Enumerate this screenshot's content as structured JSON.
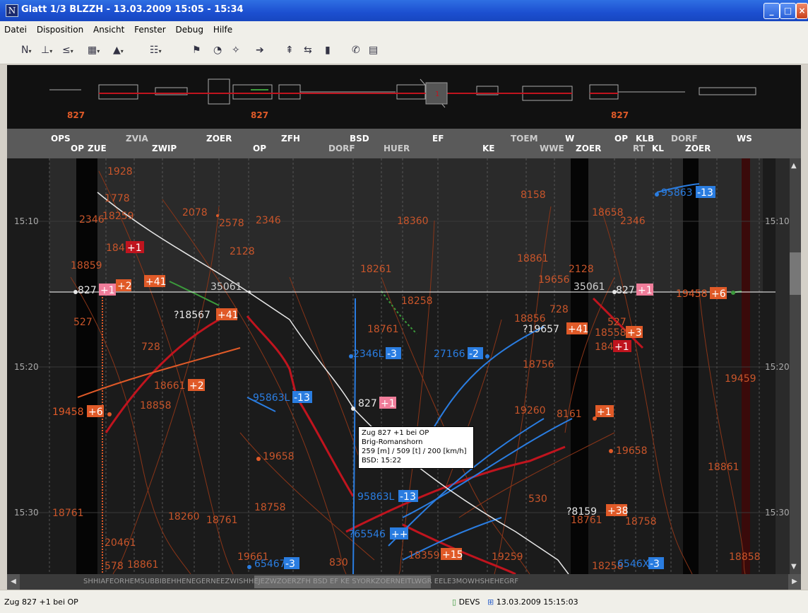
{
  "window": {
    "title": "Glatt 1/3 BLZZH - 13.03.2009 15:05 - 15:34",
    "icon": "N"
  },
  "menu": [
    "Datei",
    "Disposition",
    "Ansicht",
    "Fenster",
    "Debug",
    "Hilfe"
  ],
  "overview": {
    "train_labels": [
      "827",
      "827",
      "827"
    ],
    "box_label": "1"
  },
  "stations_top": [
    "OPS",
    "ZVIA",
    "ZOER",
    "ZFH",
    "BSD",
    "EF",
    "TOEM",
    "W",
    "OP",
    "KLB",
    "DORF",
    "WS"
  ],
  "stations_bottom": [
    "OP",
    "ZUE",
    "ZWIP",
    "OP",
    "DORF",
    "HUER",
    "KE",
    "WWE",
    "ZOER",
    "RT",
    "KL",
    "ZOER"
  ],
  "times_left": [
    "15:10",
    "15:20",
    "15:30"
  ],
  "times_right": [
    "15:10",
    "15:20",
    "15:30"
  ],
  "trains": {
    "t1928": "1928",
    "t1778": "1778",
    "t2346a": "2346",
    "t18259": "18259",
    "t2078": "2078",
    "t2578": "2578",
    "t2346b": "2346",
    "t18360": "18360",
    "t8158": "8158",
    "t95863a": "95863",
    "d95863a": "-13",
    "t18658": "18658",
    "t2346c": "2346",
    "t2128a": "2128",
    "t184a": "184",
    "d184a": "+1",
    "t18859": "18859",
    "t18261": "18261",
    "t18861a": "18861",
    "t2128b": "2128",
    "t19656": "19656",
    "t827a": "827",
    "d827a": "+1",
    "d2": "+2",
    "d41a": "+41",
    "t35061a": "35061",
    "t35061b": "35061",
    "t827b": "827",
    "d827b": "+1",
    "t19458a": "19458",
    "d6a": "+6",
    "t18258": "18258",
    "t527a": "527",
    "t728a": "728",
    "t18856": "18856",
    "t19657": "?19657",
    "d41b": "+41",
    "t18558": "18558",
    "d3": "+3",
    "t527b": "527",
    "t184b": "184",
    "d184b": "+1",
    "t18567": "?18567",
    "d41c": "+41",
    "t728b": "728",
    "t18761a": "18761",
    "t2346d": "2346L",
    "d2346d": "-3",
    "t27166": "27166",
    "d27166": "-2",
    "t18756": "18756",
    "t18661": "18661",
    "d18661": "+2",
    "t19459": "19459",
    "t18858a": "18858",
    "t95863b": "95863L",
    "d95863b": "-13",
    "t827c": "827",
    "d827c": "+1",
    "t19260": "19260",
    "t8161": "8161",
    "d8161": "+1",
    "t19458b": "19458",
    "d6b": "+6",
    "t19658a": "19658",
    "t19658b": "19658",
    "t18861b": "18861",
    "t95863c": "95863L",
    "d95863c": "-13",
    "t530": "530",
    "t18761b": "18761",
    "t18758a": "18758",
    "t18260": "18260",
    "t18761c": "18761",
    "t8159": "?8159",
    "d8159": "+38",
    "t18761d": "18761",
    "t18758b": "18758",
    "t20461": "20461",
    "t65546": "?65546",
    "d65546": "++",
    "t18359": "18359",
    "d18359": "+15",
    "t19259": "19259",
    "t578": "578",
    "t18861c": "18861",
    "t19661": "19661",
    "t65467a": "65467",
    "d65467a": "-3",
    "t830": "830",
    "t18258b": "18258",
    "t65467b": "6546X",
    "d65467b": "-3",
    "t18858b": "18858"
  },
  "tooltip": {
    "line1": "Zug 827 +1 bei OP",
    "line2": "Brig-Romanshorn",
    "line3": "259 [m] / 509 [t] / 200 [km/h]",
    "line4": "BSD: 15:22"
  },
  "scroll_stations": "SHHIAFEORHEMSUBBIBEHHENEGERNEEZWISHHEJEZWZOERZFH BSD  EF  KE   SYORKZOERNEITLWGR EELE3MOWHSHEHEGRF",
  "status": {
    "left": "Zug 827 +1 bei OP",
    "server": "DEVS",
    "datetime": "13.03.2009 15:15:03"
  },
  "colors": {
    "delay_red": "#c0141e",
    "delay_orange": "#e05a28",
    "early_blue": "#2a7de1",
    "pink": "#f07d9a",
    "train_line_orange": "#c8552a",
    "now_line": "#ffffff"
  }
}
